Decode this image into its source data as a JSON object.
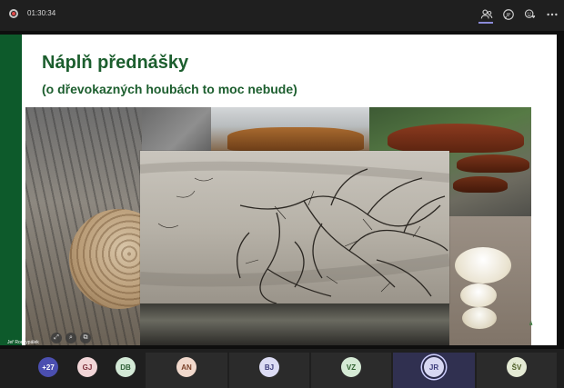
{
  "meeting": {
    "timer": "01:30:34",
    "toolbar_icons": [
      "participants-icon",
      "chat-icon",
      "reactions-icon",
      "more-icon"
    ]
  },
  "slide": {
    "title": "Náplň přednášky",
    "subtitle": "(o dřevokazných houbách to moc nebude)",
    "corner_text": "á"
  },
  "presenter": {
    "name": "Jeř Roqnypálek"
  },
  "participants": [
    {
      "initials": "+27",
      "bg": "#4b4fb0",
      "fg": "#ffffff"
    },
    {
      "initials": "GJ",
      "bg": "#f2d6d8",
      "fg": "#7a2c38"
    },
    {
      "initials": "DB",
      "bg": "#d3e9d6",
      "fg": "#2c5e34"
    },
    {
      "initials": "AN",
      "bg": "#f1d9cc",
      "fg": "#7a4128"
    },
    {
      "initials": "BJ",
      "bg": "#dcdcf4",
      "fg": "#3b3b7a"
    },
    {
      "initials": "VZ",
      "bg": "#d5ead5",
      "fg": "#2c5e2c"
    },
    {
      "initials": "JR",
      "bg": "#d7d7f2",
      "fg": "#3b3b7a"
    },
    {
      "initials": "ŠV",
      "bg": "#e4ead4",
      "fg": "#4a5a22"
    }
  ]
}
